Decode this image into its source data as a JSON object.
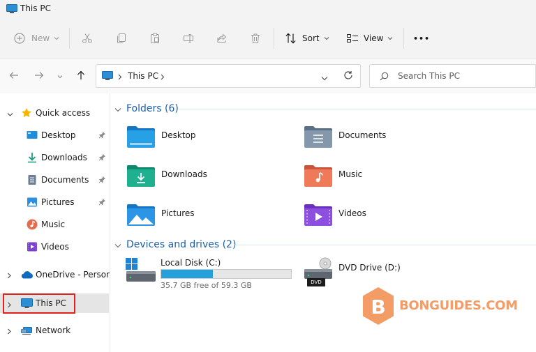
{
  "window": {
    "title": "This PC"
  },
  "toolbar": {
    "new_label": "New",
    "sort_label": "Sort",
    "view_label": "View",
    "more_label": "•••"
  },
  "address": {
    "path_label": "This PC"
  },
  "search": {
    "placeholder": "Search This PC"
  },
  "sidebar": {
    "items": [
      {
        "label": "Quick access"
      },
      {
        "label": "Desktop"
      },
      {
        "label": "Downloads"
      },
      {
        "label": "Documents"
      },
      {
        "label": "Pictures"
      },
      {
        "label": "Music"
      },
      {
        "label": "Videos"
      },
      {
        "label": "OneDrive - Personal"
      },
      {
        "label": "This PC"
      },
      {
        "label": "Network"
      }
    ]
  },
  "folders_group": {
    "header": "Folders (6)"
  },
  "folders": [
    {
      "name": "Desktop"
    },
    {
      "name": "Documents"
    },
    {
      "name": "Downloads"
    },
    {
      "name": "Music"
    },
    {
      "name": "Pictures"
    },
    {
      "name": "Videos"
    }
  ],
  "drives_group": {
    "header": "Devices and drives (2)"
  },
  "drives": [
    {
      "name": "Local Disk (C:)",
      "free_text": "35.7 GB free of 59.3 GB",
      "used_fraction": 0.398
    },
    {
      "name": "DVD Drive (D:)",
      "badge": "DVD"
    }
  ],
  "watermark": {
    "logo_letter": "B",
    "text": "BONGUIDES.COM"
  },
  "colors": {
    "accent": "#1c5fa8",
    "selection": "#e5e5e5",
    "highlight": "#e0201a",
    "progress": "#26a0da",
    "watermark": "#f28b4b"
  }
}
